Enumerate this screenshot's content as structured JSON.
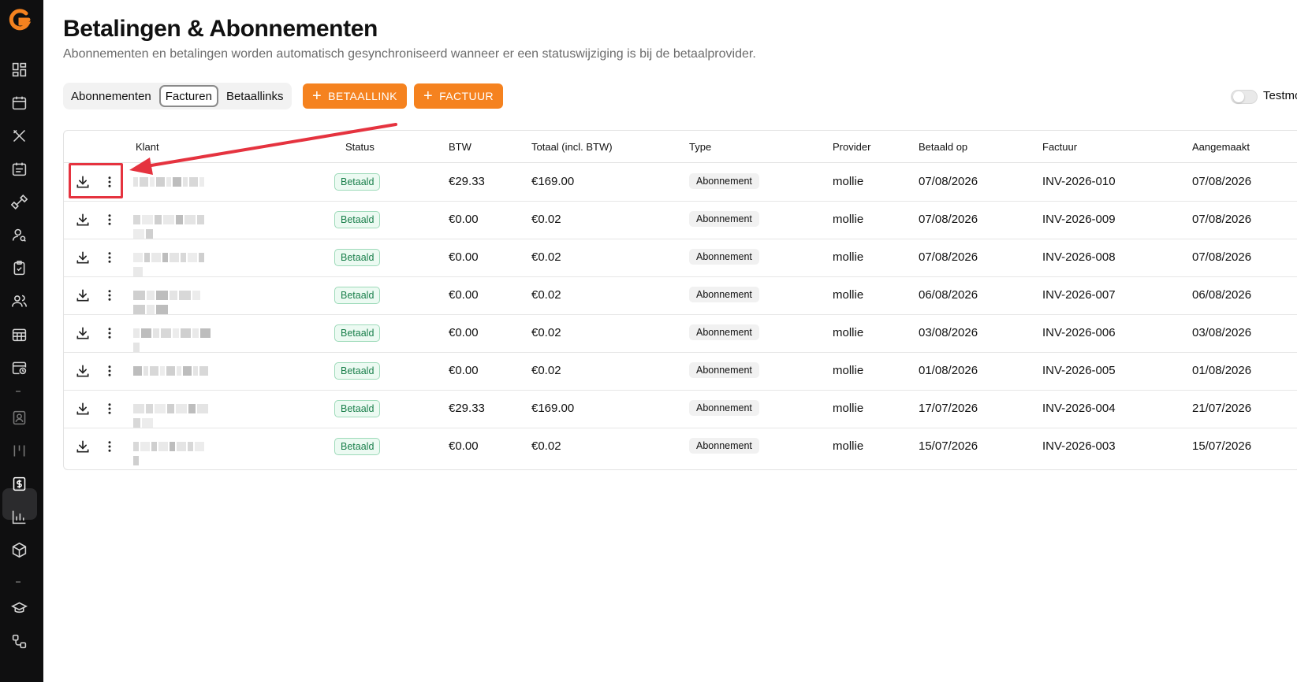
{
  "brand": {
    "accent": "#f5821f",
    "sidebar_bg": "#0f0f10"
  },
  "sidebar": {
    "items": [
      {
        "icon": "dashboard-icon"
      },
      {
        "icon": "calendar-icon"
      },
      {
        "icon": "tools-icon"
      },
      {
        "icon": "calendar-list-icon"
      },
      {
        "icon": "dumbbell-icon"
      },
      {
        "icon": "user-search-icon"
      },
      {
        "icon": "clipboard-check-icon"
      },
      {
        "icon": "users-icon"
      },
      {
        "icon": "calendar-grid-icon"
      },
      {
        "icon": "calendar-clock-icon"
      },
      {
        "icon": "contact-card-icon"
      },
      {
        "icon": "columns-icon"
      },
      {
        "icon": "dollar-icon",
        "active": true
      },
      {
        "icon": "bar-chart-icon"
      },
      {
        "icon": "package-icon"
      },
      {
        "icon": "graduation-cap-icon"
      },
      {
        "icon": "workflow-icon"
      }
    ]
  },
  "header": {
    "title": "Betalingen & Abonnementen",
    "subtitle": "Abonnementen en betalingen worden automatisch gesynchroniseerd wanneer er een statuswijziging is bij de betaalprovider."
  },
  "tabs": [
    {
      "label": "Abonnementen",
      "active": false
    },
    {
      "label": "Facturen",
      "active": true
    },
    {
      "label": "Betaallinks",
      "active": false
    }
  ],
  "buttons": {
    "betaallink": "BETAALLINK",
    "factuur": "FACTUUR"
  },
  "testmode": {
    "label": "Testmo",
    "on": false
  },
  "table": {
    "headers": {
      "klant": "Klant",
      "status": "Status",
      "btw": "BTW",
      "totaal": "Totaal (incl. BTW)",
      "type": "Type",
      "provider": "Provider",
      "betaald_op": "Betaald op",
      "factuur": "Factuur",
      "aangemaakt": "Aangemaakt"
    },
    "rows": [
      {
        "status": "Betaald",
        "btw": "€29.33",
        "totaal": "€169.00",
        "type": "Abonnement",
        "provider": "mollie",
        "betaald_op": "07/08/2026",
        "factuur": "INV-2026-010",
        "aangemaakt": "07/08/2026"
      },
      {
        "status": "Betaald",
        "btw": "€0.00",
        "totaal": "€0.02",
        "type": "Abonnement",
        "provider": "mollie",
        "betaald_op": "07/08/2026",
        "factuur": "INV-2026-009",
        "aangemaakt": "07/08/2026"
      },
      {
        "status": "Betaald",
        "btw": "€0.00",
        "totaal": "€0.02",
        "type": "Abonnement",
        "provider": "mollie",
        "betaald_op": "07/08/2026",
        "factuur": "INV-2026-008",
        "aangemaakt": "07/08/2026"
      },
      {
        "status": "Betaald",
        "btw": "€0.00",
        "totaal": "€0.02",
        "type": "Abonnement",
        "provider": "mollie",
        "betaald_op": "06/08/2026",
        "factuur": "INV-2026-007",
        "aangemaakt": "06/08/2026"
      },
      {
        "status": "Betaald",
        "btw": "€0.00",
        "totaal": "€0.02",
        "type": "Abonnement",
        "provider": "mollie",
        "betaald_op": "03/08/2026",
        "factuur": "INV-2026-006",
        "aangemaakt": "03/08/2026"
      },
      {
        "status": "Betaald",
        "btw": "€0.00",
        "totaal": "€0.02",
        "type": "Abonnement",
        "provider": "mollie",
        "betaald_op": "01/08/2026",
        "factuur": "INV-2026-005",
        "aangemaakt": "01/08/2026"
      },
      {
        "status": "Betaald",
        "btw": "€29.33",
        "totaal": "€169.00",
        "type": "Abonnement",
        "provider": "mollie",
        "betaald_op": "17/07/2026",
        "factuur": "INV-2026-004",
        "aangemaakt": "21/07/2026"
      },
      {
        "status": "Betaald",
        "btw": "€0.00",
        "totaal": "€0.02",
        "type": "Abonnement",
        "provider": "mollie",
        "betaald_op": "15/07/2026",
        "factuur": "INV-2026-003",
        "aangemaakt": "15/07/2026"
      }
    ]
  },
  "annotation": {
    "highlight_color": "#e5333f"
  }
}
